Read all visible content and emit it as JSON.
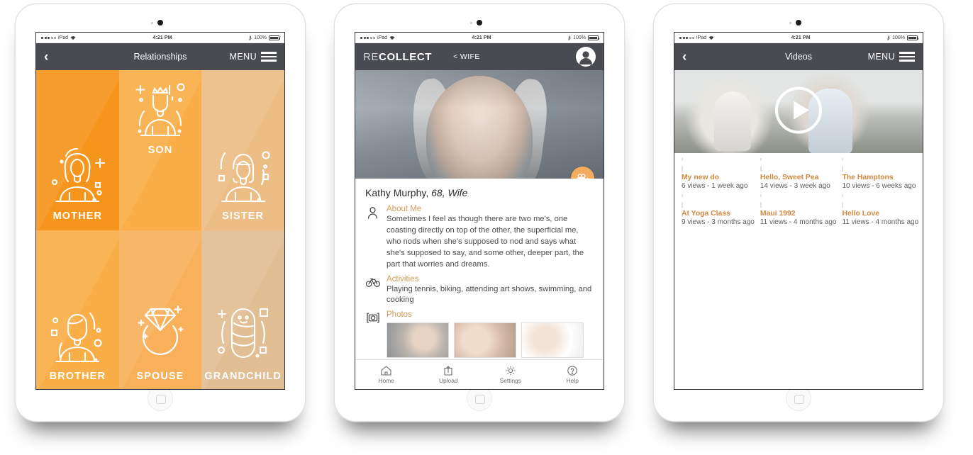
{
  "statusbar": {
    "carrier": "iPad",
    "time": "4:21 PM",
    "battery": "100%"
  },
  "colors": {
    "tile_dark": "#F6951C",
    "tile_mid": "#F9AE47",
    "tile_light": "#EDBD86",
    "navbar": "#4A4B51",
    "accent_orange": "#D1883F",
    "accent_heading": "#D69A54",
    "fab": "#F6AC5E"
  },
  "screen_relationships": {
    "nav": {
      "back": "‹",
      "title": "Relationships",
      "menu_label": "MENU"
    },
    "tiles": [
      {
        "label": "MOTHER",
        "icon": "woman-icon",
        "tone": "dark"
      },
      {
        "label": "SON",
        "icon": "boy-crown-icon",
        "tone": "mid"
      },
      {
        "label": "SISTER",
        "icon": "girl-icon",
        "tone": "light"
      },
      {
        "label": "BROTHER",
        "icon": "man-icon",
        "tone": "mid"
      },
      {
        "label": "SPOUSE",
        "icon": "ring-icon",
        "tone": "mid-light"
      },
      {
        "label": "GRANDCHILD",
        "icon": "baby-icon",
        "tone": "tan"
      }
    ]
  },
  "screen_profile": {
    "brand_light": "RE",
    "brand_bold": "COLLECT",
    "breadcrumb": "< WIFE",
    "avatar_icon": "user-avatar-icon",
    "fab_icon": "video-camera-icon",
    "name_line": {
      "name": "Kathy Murphy,",
      "age": "68,",
      "relation": "Wife"
    },
    "sections": [
      {
        "icon": "person-icon",
        "heading": "About Me",
        "text": "Sometimes I feel as though there are two me's, one coasting directly on top of the other, the superficial me, who nods when she's supposed to nod and says what she's supposed to say, and some other, deeper part, the part that worries and dreams."
      },
      {
        "icon": "bicycle-icon",
        "heading": "Activities",
        "text": "Playing tennis, biking, attending art shows, swimming, and cooking"
      },
      {
        "icon": "camera-icon",
        "heading": "Photos",
        "text": ""
      }
    ],
    "tabs": [
      {
        "label": "Home",
        "icon": "home-icon"
      },
      {
        "label": "Upload",
        "icon": "upload-icon"
      },
      {
        "label": "Settings",
        "icon": "gear-icon"
      },
      {
        "label": "Help",
        "icon": "help-icon"
      }
    ]
  },
  "screen_videos": {
    "nav": {
      "back": "‹",
      "title": "Videos",
      "menu_label": "MENU"
    },
    "hero_play_icon": "play-icon",
    "videos": [
      {
        "title": "My new do",
        "meta": "6 views - 1 week ago"
      },
      {
        "title": "Hello, Sweet Pea",
        "meta": "14 views - 3 week ago"
      },
      {
        "title": "The Hamptons",
        "meta": "10 views - 6 weeks ago"
      },
      {
        "title": "At Yoga Class",
        "meta": "9 views - 3 months ago"
      },
      {
        "title": "Maui 1992",
        "meta": "11 views - 4 months ago"
      },
      {
        "title": "Hello Love",
        "meta": "11 views - 4 months ago"
      }
    ]
  }
}
